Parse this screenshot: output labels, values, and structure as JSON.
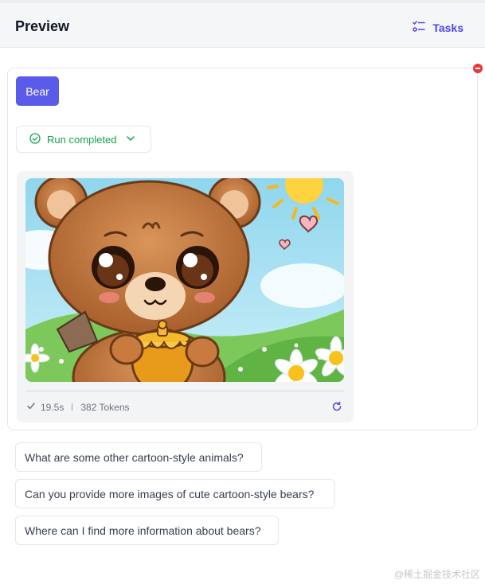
{
  "header": {
    "title": "Preview",
    "tasks_label": "Tasks"
  },
  "tag": {
    "label": "Bear"
  },
  "status": {
    "label": "Run completed"
  },
  "result": {
    "duration": "19.5s",
    "tokens": "382 Tokens"
  },
  "suggestions": [
    "What are some other cartoon-style animals?",
    "Can you provide more images of cute cartoon-style bears?",
    "Where can I find more information about bears?"
  ],
  "watermark": "@稀土掘金技术社区",
  "colors": {
    "accent": "#5b5bea",
    "success": "#16a34a",
    "danger": "#e53935"
  },
  "icons": [
    "tasks-icon",
    "check-circle-icon",
    "chevron-down-icon",
    "checkmark-icon",
    "refresh-icon",
    "remove-icon"
  ]
}
